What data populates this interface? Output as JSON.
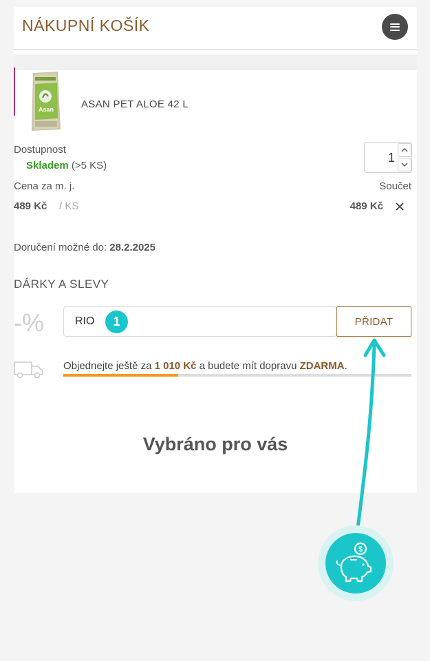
{
  "header": {
    "title": "NÁKUPNÍ KOŠÍK",
    "menu_icon": "hamburger-icon"
  },
  "cart_item": {
    "name": "ASAN PET ALOE 42 L",
    "availability_label": "Dostupnost",
    "stock_status": "Skladem",
    "stock_detail": "(>5 KS)",
    "quantity": "1",
    "unit_price_label": "Cena za m. j.",
    "total_label": "Součet",
    "unit_price": "489 Kč",
    "unit_suffix": "/ KS",
    "total_price": "489 Kč",
    "remove_icon": "close-icon"
  },
  "delivery": {
    "label": "Doručení možné do:",
    "date": "28.2.2025"
  },
  "gifts": {
    "title": "DÁRKY A SLEVY",
    "percent_symbol": "-%",
    "coupon_value": "RIO",
    "step_badge": "1",
    "add_button": "PŘIDAT"
  },
  "shipping": {
    "prefix": "Objednejte ještě za",
    "amount": "1 010 Kč",
    "middle": "a budete mít dopravu",
    "free": "ZDARMA",
    "suffix": ".",
    "progress_fraction": 0.33
  },
  "recommendations": {
    "title": "Vybráno pro vás"
  },
  "colors": {
    "brand_brown": "#8b5a2b",
    "teal": "#1ac6c9",
    "stock_green": "#3a9a2a",
    "progress_orange": "#f39a1e"
  }
}
